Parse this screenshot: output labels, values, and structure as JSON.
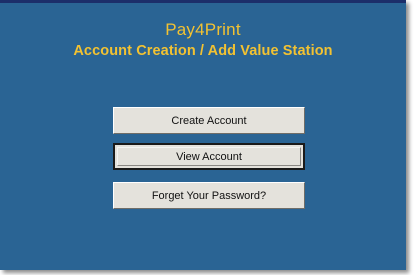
{
  "header": {
    "app_name": "Pay4Print",
    "subtitle": "Account Creation / Add Value Station"
  },
  "actions": {
    "create_account_label": "Create Account",
    "view_account_label": "View Account",
    "forgot_password_label": "Forget Your Password?"
  },
  "colors": {
    "background": "#2a6494",
    "title_text": "#f2c232",
    "button_face": "#e4e2dc",
    "top_border": "#1c2e6a"
  }
}
